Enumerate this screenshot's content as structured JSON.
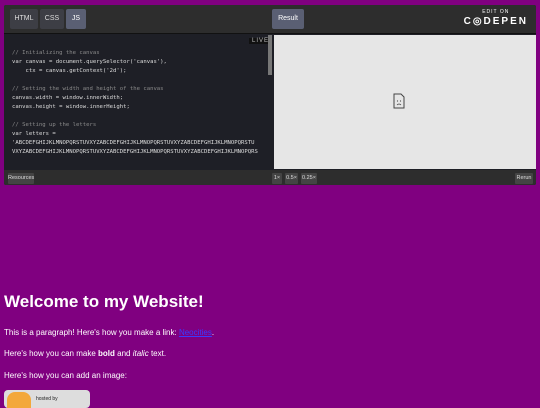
{
  "tabs": {
    "html": "HTML",
    "css": "CSS",
    "js": "JS",
    "result": "Result"
  },
  "brand": {
    "edit_on": "EDIT ON",
    "name": "C◎DEPEN"
  },
  "live_badge": "LIVE",
  "code_lines": [
    {
      "cls": "c-comment",
      "text": "// Initializing the canvas"
    },
    {
      "cls": "",
      "text": "var canvas = document.querySelector('canvas'),"
    },
    {
      "cls": "",
      "text": "    ctx = canvas.getContext('2d');"
    },
    {
      "cls": "",
      "text": ""
    },
    {
      "cls": "c-comment",
      "text": "// Setting the width and height of the canvas"
    },
    {
      "cls": "",
      "text": "canvas.width = window.innerWidth;"
    },
    {
      "cls": "",
      "text": "canvas.height = window.innerHeight;"
    },
    {
      "cls": "",
      "text": ""
    },
    {
      "cls": "c-comment",
      "text": "// Setting up the letters"
    },
    {
      "cls": "",
      "text": "var letters ="
    },
    {
      "cls": "c-str2",
      "text": "'ABCDEFGHIJKLMNOPQRSTUVXYZABCDEFGHIJKLMNOPQRSTUVXYZABCDEFGHIJKLMNOPQRSTU"
    },
    {
      "cls": "c-str2",
      "text": "VXYZABCDEFGHIJKLMNOPQRSTUVXYZABCDEFGHIJKLMNOPQRSTUVXYZABCDEFGHIJKLMNOPQRS"
    }
  ],
  "bottom": {
    "resources": "Resources",
    "zoom1": "1×",
    "zoom05": "0.5×",
    "zoom025": "0.25×",
    "rerun": "Rerun"
  },
  "page": {
    "heading": "Welcome to my Website!",
    "p1_before": "This is a paragraph! Here's how you make a link: ",
    "p1_link": "Neocities",
    "p1_after": ".",
    "p2_before": "Here's how you can make ",
    "p2_bold": "bold",
    "p2_mid": " and ",
    "p2_italic": "italic",
    "p2_after": " text.",
    "p3": "Here's how you can add an image:",
    "image_caption": "hosted by"
  }
}
